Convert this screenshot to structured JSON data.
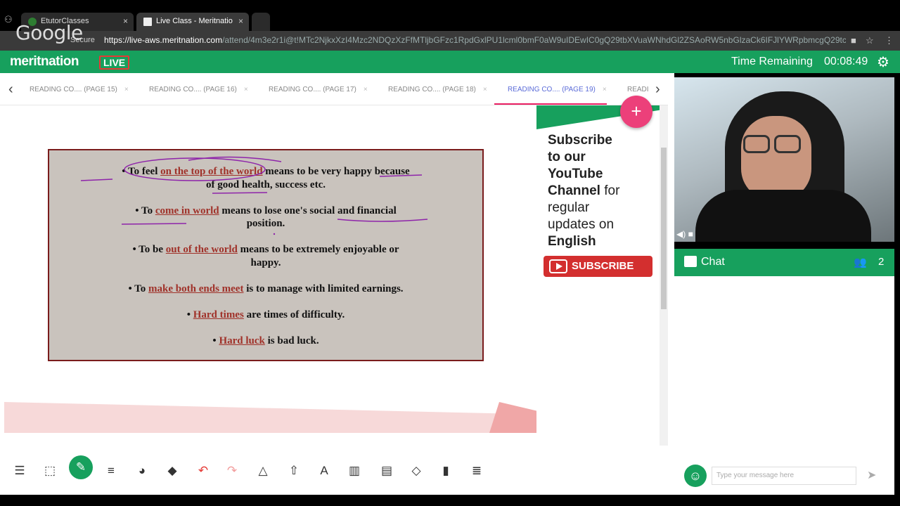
{
  "browser": {
    "tabs": [
      {
        "title": "EtutorClasses"
      },
      {
        "title": "Live Class - Meritnatio"
      }
    ],
    "logo_overlay": "Google",
    "secure_label": "Secure",
    "url_host": "https://live-aws.meritnation.com",
    "url_path": "/attend/4m3e2r1i@t!MTc2NjkxXzI4Mzc2NDQzXzFfMTljbGFzc1RpdGxlPU1lcml0bmF0aW9uIDEwIC0gQ29tbXVuaWNhdGl2ZSAoRW5nbGlzaCk6IFJlYWRpbmcgQ29tcHJlaGVuc2lvbiBJlaGV..."
  },
  "header": {
    "brand": "meritnation",
    "live_label": "LIVE",
    "time_label": "Time Remaining",
    "time_value": "00:08:49"
  },
  "page_tabs": [
    {
      "label": "READING CO.... (PAGE 15)",
      "close": "×"
    },
    {
      "label": "READING CO.... (PAGE 16)",
      "close": "×"
    },
    {
      "label": "READING CO.... (PAGE 17)",
      "close": "×"
    },
    {
      "label": "READING CO.... (PAGE 18)",
      "close": "×"
    },
    {
      "label": "READING CO.... (PAGE 19)",
      "close": "×"
    },
    {
      "label": "READII",
      "close": ""
    }
  ],
  "slide": {
    "lines": [
      {
        "pre": "• To feel ",
        "hi": "on the top of the world",
        "post": " means to be very happy because"
      },
      {
        "pre": "of good health, success etc.",
        "hi": "",
        "post": ""
      },
      {
        "pre": "• To ",
        "hi": "come in world",
        "post": " means to lose one's social and financial"
      },
      {
        "pre": "position.",
        "hi": "",
        "post": ""
      },
      {
        "pre": "• To be ",
        "hi": "out of the world",
        "post": " means to be extremely enjoyable or"
      },
      {
        "pre": "happy.",
        "hi": "",
        "post": ""
      },
      {
        "pre": "• To ",
        "hi": "make both ends meet",
        "post": " is to manage with limited earnings."
      },
      {
        "pre": "• ",
        "hi": "Hard times",
        "post": " are times of difficulty."
      },
      {
        "pre": "• ",
        "hi": "Hard luck",
        "post": " is bad luck."
      }
    ]
  },
  "promo": {
    "line1": "Subscribe",
    "line2": "to our",
    "line3": "YouTube",
    "line4a": "Channel",
    "line4b": " for",
    "line5": "regular",
    "line6": "updates on",
    "line7": "English",
    "button": "SUBSCRIBE"
  },
  "fab_label": "+",
  "tools": [
    "list-icon",
    "select-icon",
    "pen-icon",
    "lines-icon",
    "palette-icon",
    "fill-icon",
    "undo-icon",
    "redo-icon",
    "shapes-icon",
    "upload-icon",
    "text-icon",
    "chart-icon",
    "clipboard-icon",
    "eraser-icon",
    "delete-icon",
    "menu-icon"
  ],
  "chat": {
    "title": "Chat",
    "participants": "2",
    "placeholder": "Type your message here"
  },
  "colors": {
    "brand_green": "#17a05d",
    "accent_pink": "#ec407a",
    "slide_red": "#a0322a"
  }
}
